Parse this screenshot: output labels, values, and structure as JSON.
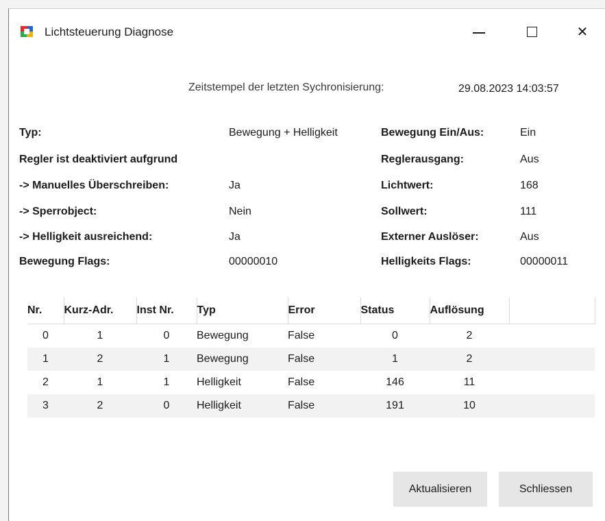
{
  "window": {
    "title": "Lichtsteuerung Diagnose",
    "minimize_symbol": "—",
    "maximize_symbol": "☐",
    "close_symbol": "✕"
  },
  "sync": {
    "label": "Zeitstempel der letzten Sychronisierung:",
    "value": "29.08.2023 14:03:57"
  },
  "left": {
    "typ_label": "Typ:",
    "typ_value": "Bewegung + Helligkeit",
    "regler_label": "Regler ist deaktiviert aufgrund",
    "manual_label": "-> Manuelles Überschreiben:",
    "manual_value": "Ja",
    "sperr_label": "-> Sperrobject:",
    "sperr_value": "Nein",
    "hell_label": "-> Helligkeit ausreichend:",
    "hell_value": "Ja",
    "flags_label": "Bewegung Flags:",
    "flags_value": "00000010"
  },
  "right": {
    "motion_label": "Bewegung Ein/Aus:",
    "motion_value": "Ein",
    "output_label": "Reglerausgang:",
    "output_value": "Aus",
    "light_label": "Lichtwert:",
    "light_value": "168",
    "target_label": "Sollwert:",
    "target_value": "111",
    "ext_label": "Externer Auslöser:",
    "ext_value": "Aus",
    "hflags_label": "Helligkeits Flags:",
    "hflags_value": "00000011"
  },
  "table": {
    "headers": [
      "Nr.",
      "Kurz-Adr.",
      "Inst Nr.",
      "Typ",
      "Error",
      "Status",
      "Auflösung"
    ],
    "rows": [
      [
        "0",
        "1",
        "0",
        "Bewegung",
        "False",
        "0",
        "2"
      ],
      [
        "1",
        "2",
        "1",
        "Bewegung",
        "False",
        "1",
        "2"
      ],
      [
        "2",
        "1",
        "1",
        "Helligkeit",
        "False",
        "146",
        "11"
      ],
      [
        "3",
        "2",
        "0",
        "Helligkeit",
        "False",
        "191",
        "10"
      ]
    ]
  },
  "buttons": {
    "refresh": "Aktualisieren",
    "close": "Schliessen"
  },
  "colors": {
    "window_bg": "#ffffff",
    "alt_row": "#f2f2f2",
    "button_bg": "#e6e6e6"
  }
}
